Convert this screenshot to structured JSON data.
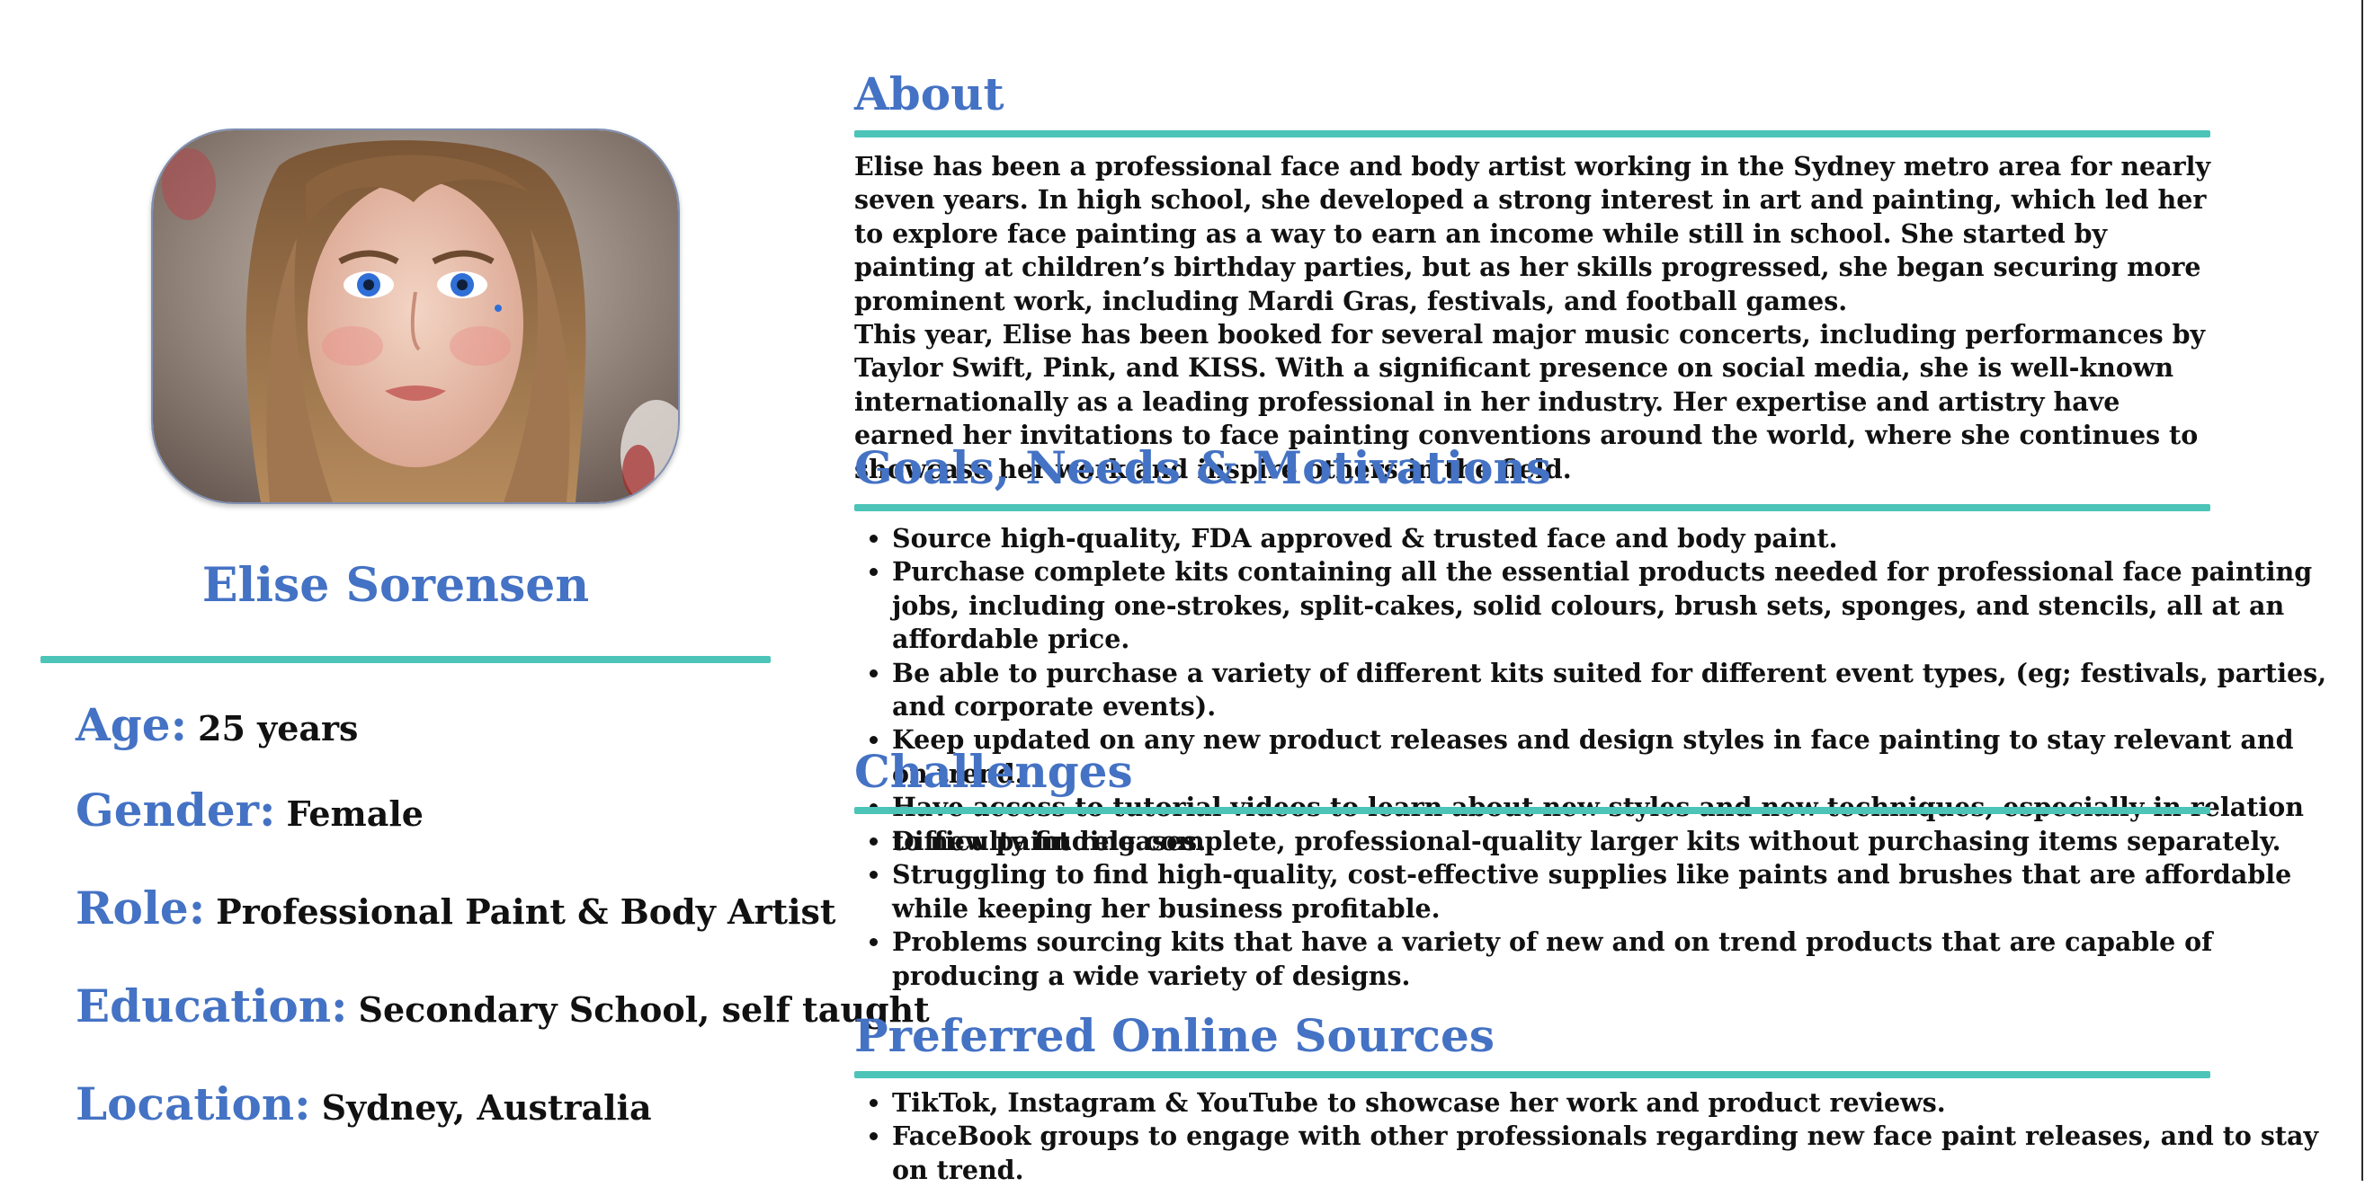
{
  "profile": {
    "name": "Elise Sorensen",
    "photo_icon": "portrait-photo",
    "details": {
      "age_label": "Age:",
      "age_value": "25 years",
      "gender_label": "Gender:",
      "gender_value": "Female",
      "role_label": "Role:",
      "role_value": "Professional Paint & Body Artist",
      "education_label": "Education:",
      "education_value": "Secondary School, self taught",
      "location_label": "Location:",
      "location_value": "Sydney, Australia"
    }
  },
  "about": {
    "title": "About",
    "paragraphs": [
      "Elise has been a professional face and body artist working in the Sydney metro area for nearly seven years. In high school, she developed a strong interest in art and painting, which led her to explore face painting as a way to earn an income while still in school. She started by painting at children’s birthday parties, but as her skills progressed, she began securing more prominent work, including Mardi Gras, festivals, and football games.",
      "This year, Elise has been booked for several major music concerts, including performances by Taylor Swift, Pink, and KISS. With a significant presence on social media, she is well-known internationally as a leading professional in her industry. Her expertise and artistry have earned her invitations to face painting conventions around the world, where she continues to showcase her work and inspire others in the field."
    ]
  },
  "goals": {
    "title": "Goals, Needs & Motivations",
    "items": [
      "Source high-quality,  FDA approved & trusted  face and body paint.",
      "Purchase complete kits containing all the essential products needed for professional face painting jobs, including one-strokes, split-cakes, solid colours, brush sets, sponges, and stencils, all at an affordable price.",
      "Be able to purchase a variety of different kits suited for different event types, (eg; festivals,  parties, and  corporate events).",
      "Keep updated on any new product releases and design styles in face painting to stay relevant and on trend.",
      "Have access to tutorial videos to learn about new styles and new techniques, especially in relation to new paint releases."
    ]
  },
  "challenges": {
    "title": "Challenges",
    "items": [
      "Difficulty finding complete, professional-quality larger kits without purchasing items separately.",
      "Struggling to find high-quality, cost-effective supplies like paints and brushes that are affordable while keeping her business profitable.",
      "Problems sourcing kits that have a variety of new and on trend products that are capable of producing a wide variety of designs."
    ]
  },
  "sources": {
    "title": "Preferred Online Sources",
    "items": [
      "TikTok, Instagram & YouTube to showcase her work and product reviews.",
      "FaceBook groups to engage with other professionals regarding new face paint releases, and to stay on trend."
    ]
  },
  "colors": {
    "heading": "#4472c4",
    "rule": "#4cc4b8",
    "text": "#111111"
  }
}
